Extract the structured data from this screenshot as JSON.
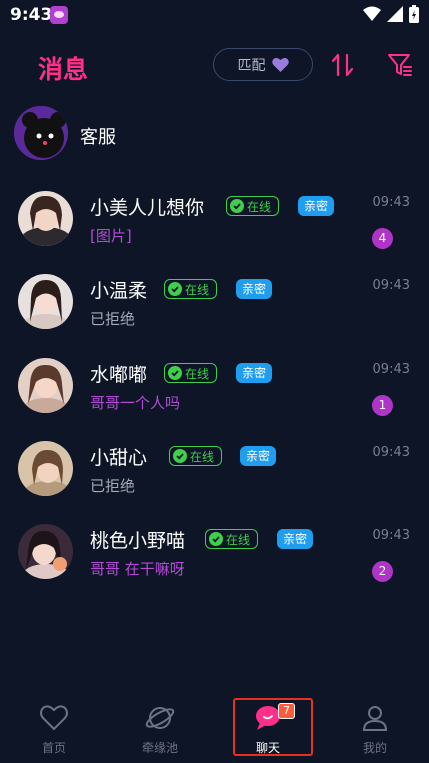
{
  "status_bar": {
    "time": "9:43"
  },
  "header": {
    "title": "消息",
    "match_label": "匹配"
  },
  "customer_service": {
    "name": "客服"
  },
  "badges": {
    "online": "在线",
    "intimate": "亲密"
  },
  "chats": [
    {
      "name": "小美人儿想你",
      "preview": "[图片]",
      "preview_style": "purple",
      "time": "09:43",
      "unread": "4"
    },
    {
      "name": "小温柔",
      "preview": "已拒绝",
      "preview_style": "gray",
      "time": "09:43",
      "unread": ""
    },
    {
      "name": "水嘟嘟",
      "preview": "哥哥一个人吗",
      "preview_style": "purple",
      "time": "09:43",
      "unread": "1"
    },
    {
      "name": "小甜心",
      "preview": "已拒绝",
      "preview_style": "gray",
      "time": "09:43",
      "unread": ""
    },
    {
      "name": "桃色小野喵",
      "preview": "哥哥 在干嘛呀",
      "preview_style": "purple",
      "time": "09:43",
      "unread": "2"
    }
  ],
  "bottom_nav": {
    "items": [
      {
        "label": "首页",
        "icon": "heart-icon"
      },
      {
        "label": "牵缘池",
        "icon": "planet-icon"
      },
      {
        "label": "聊天",
        "icon": "chat-bubble-icon",
        "active": true,
        "count": "7"
      },
      {
        "label": "我的",
        "icon": "person-icon"
      }
    ]
  },
  "colors": {
    "background": "#0d1526",
    "title_pink": "#ff2f8a",
    "online_green": "#3fcf4a",
    "intimate_blue": "#1f9ef0",
    "unread_purple": "#b034c8",
    "preview_purple": "#b34bd6"
  }
}
